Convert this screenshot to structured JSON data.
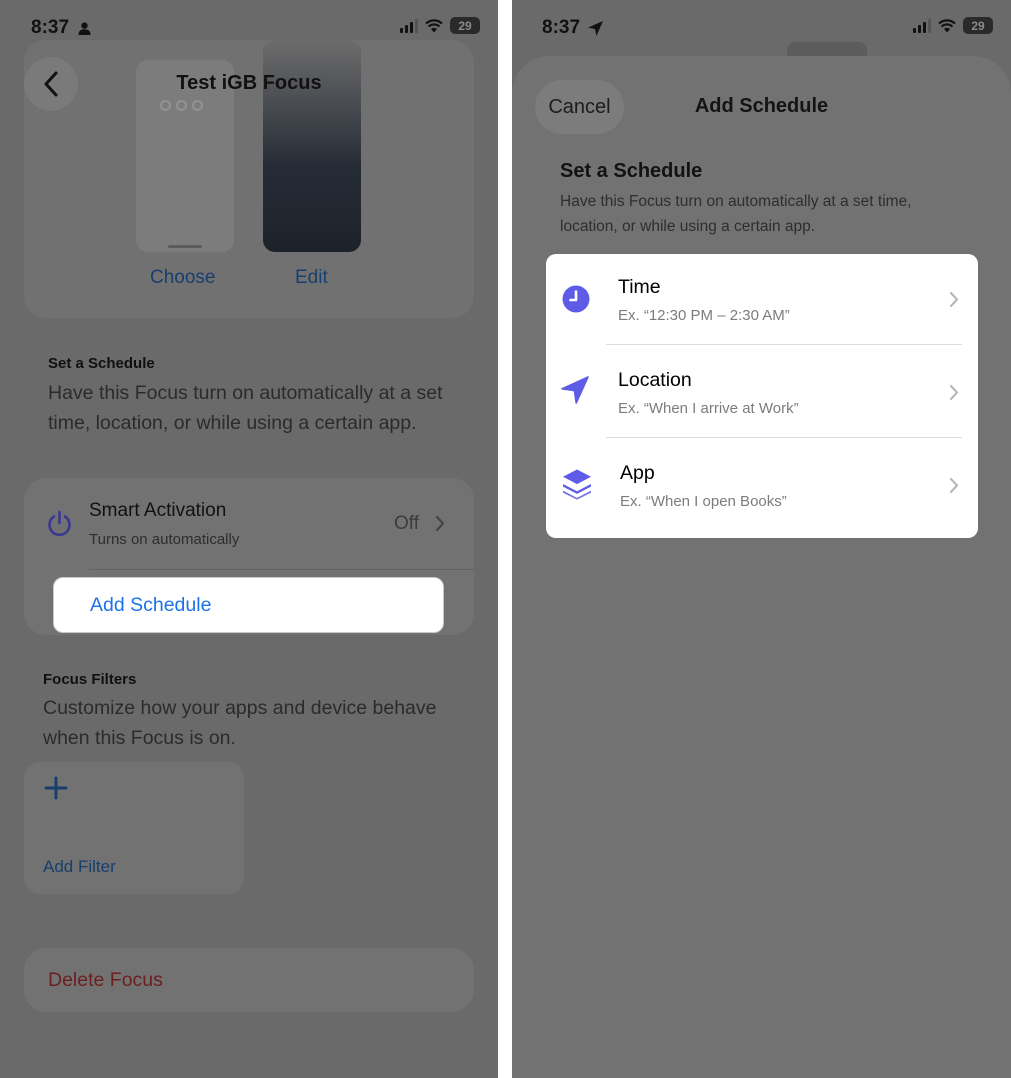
{
  "left": {
    "status": {
      "time": "8:37",
      "battery": "29"
    },
    "nav": {
      "title": "Test iGB Focus"
    },
    "preview": {
      "choose_label": "Choose",
      "edit_label": "Edit"
    },
    "schedule_section": {
      "header": "Set a Schedule",
      "description": "Have this Focus turn on automatically at a set time, location, or while using a certain app."
    },
    "smart_activation": {
      "title": "Smart Activation",
      "subtitle": "Turns on automatically",
      "value": "Off"
    },
    "add_schedule_label": "Add Schedule",
    "filters_section": {
      "header": "Focus Filters",
      "description": "Customize how your apps and device behave when this Focus is on.",
      "add_filter_label": "Add Filter"
    },
    "delete_label": "Delete Focus"
  },
  "right": {
    "status": {
      "time": "8:37",
      "battery": "29"
    },
    "sheet": {
      "cancel_label": "Cancel",
      "title": "Add Schedule",
      "header": "Set a Schedule",
      "description": "Have this Focus turn on automatically at a set time, location, or while using a certain app."
    },
    "options": [
      {
        "title": "Time",
        "subtitle": "Ex. “12:30 PM – 2:30 AM”",
        "icon": "clock-icon"
      },
      {
        "title": "Location",
        "subtitle": "Ex. “When I arrive at Work”",
        "icon": "location-arrow-icon"
      },
      {
        "title": "App",
        "subtitle": "Ex. “When I open Books”",
        "icon": "app-layers-icon"
      }
    ]
  },
  "colors": {
    "accent_blue": "#1a73e8",
    "icon_purple": "#5e5ce6",
    "destructive_red": "#6b1f1f",
    "dim_overlay": "#6a6a6a"
  }
}
